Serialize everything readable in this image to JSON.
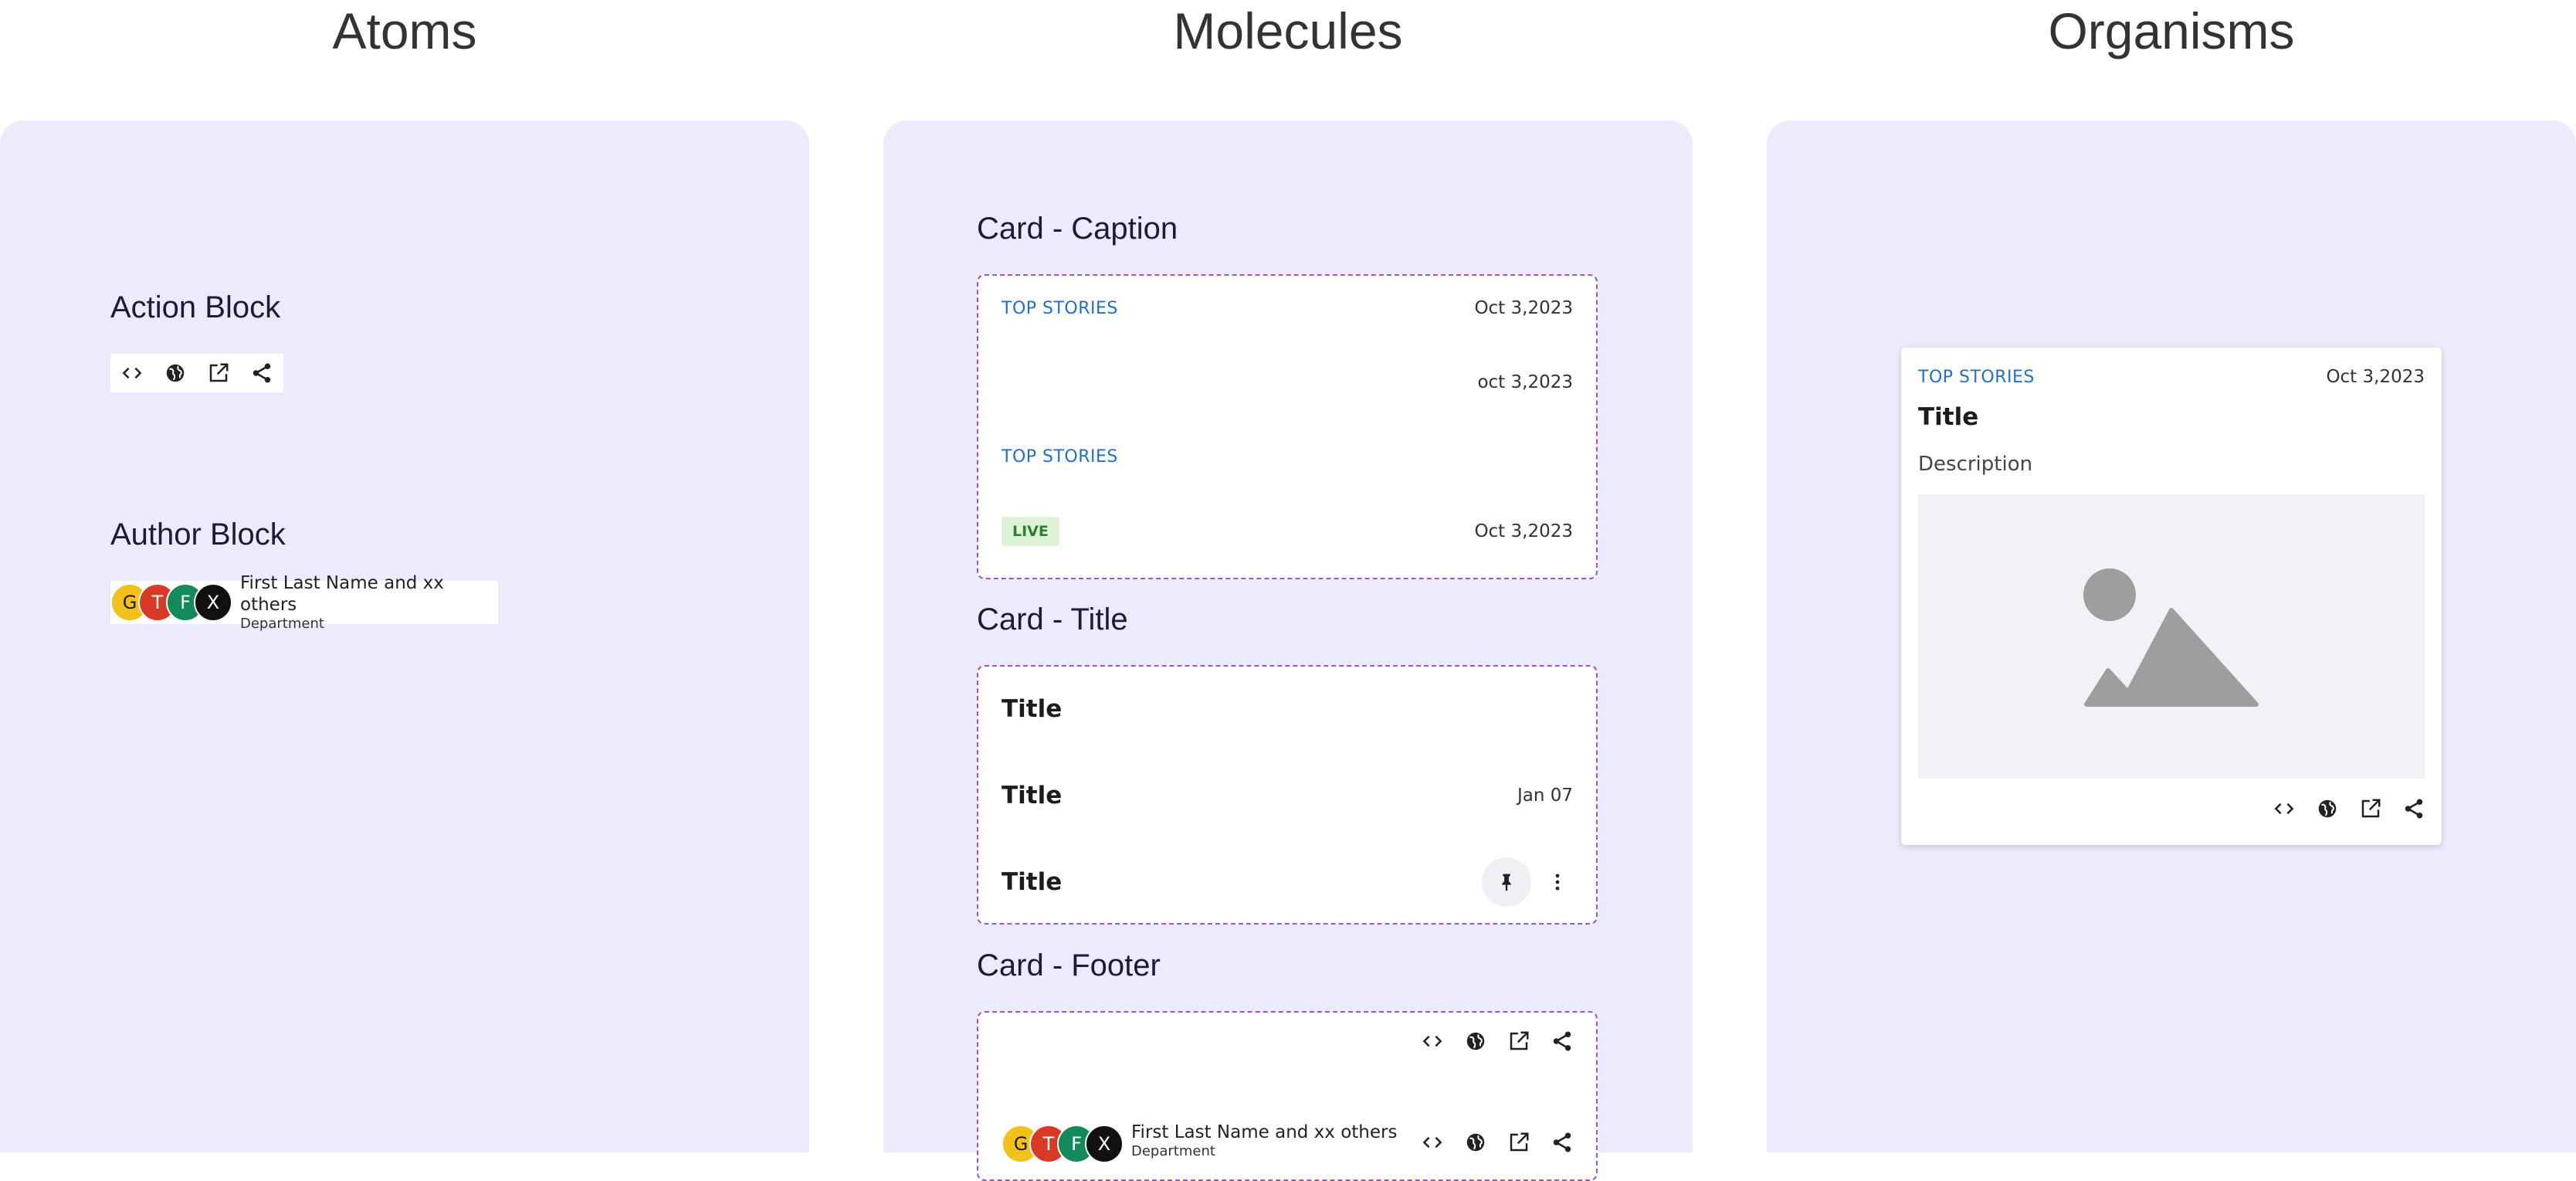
{
  "columns": {
    "atoms": "Atoms",
    "molecules": "Molecules",
    "organisms": "Organisms"
  },
  "atoms": {
    "action_block_title": "Action Block",
    "author_block_title": "Author Block",
    "action_icons": [
      "code-icon",
      "globe-icon",
      "open-external-icon",
      "share-icon"
    ],
    "author": {
      "avatars": [
        {
          "letter": "G",
          "color": "#f2c21b",
          "text_color": "#1a1a1a"
        },
        {
          "letter": "T",
          "color": "#d93a26",
          "text_color": "#ffffff"
        },
        {
          "letter": "F",
          "color": "#138a5a",
          "text_color": "#ffffff"
        },
        {
          "letter": "X",
          "color": "#111111",
          "text_color": "#ffffff"
        }
      ],
      "name": "First Last Name and xx others",
      "department": "Department"
    }
  },
  "molecules": {
    "caption": {
      "title": "Card - Caption",
      "row1_kicker": "TOP STORIES",
      "row1_date": "Oct 3,2023",
      "row2_date": "oct 3,2023",
      "row3_kicker": "TOP STORIES",
      "row4_badge": "LIVE",
      "row4_date": "Oct 3,2023"
    },
    "title_card": {
      "title": "Card - Title",
      "row1_title": "Title",
      "row2_title": "Title",
      "row2_date": "Jan 07",
      "row3_title": "Title"
    },
    "footer": {
      "title": "Card - Footer",
      "author_name": "First Last Name and xx others",
      "author_department": "Department"
    }
  },
  "organisms": {
    "card": {
      "kicker": "TOP STORIES",
      "date": "Oct 3,2023",
      "title": "Title",
      "description": "Description"
    }
  },
  "colors": {
    "panel_bg": "#ecebfd",
    "accent_link": "#1f6fcf",
    "dashed_border": "#9b51e0",
    "live_bg": "#dff3d8",
    "live_text": "#2e7d32"
  }
}
